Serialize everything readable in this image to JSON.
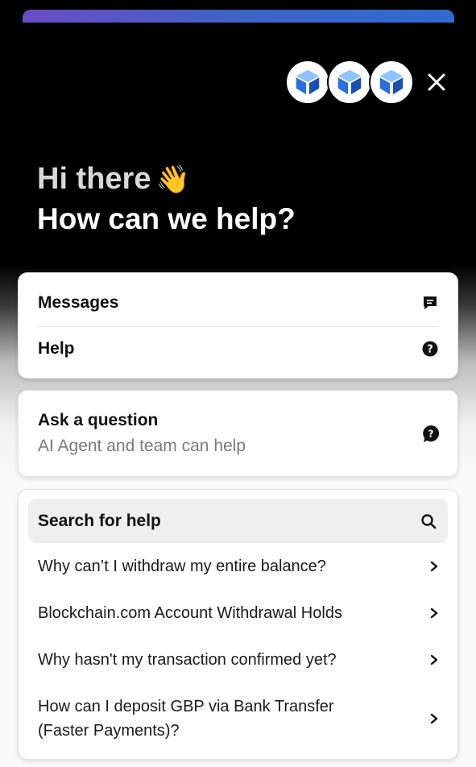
{
  "header": {
    "greeting": "Hi there",
    "wave_emoji": "👋",
    "headline": "How can we help?",
    "avatar_icon": "blockchain-cube-icon",
    "close_icon": "close-icon",
    "accent_gradient": [
      "#6a4cc6",
      "#2f6bd0"
    ]
  },
  "home_card": {
    "messages_label": "Messages",
    "messages_icon": "message-icon",
    "help_label": "Help",
    "help_icon": "question-circle-icon"
  },
  "ask_card": {
    "title": "Ask a question",
    "subtitle": "AI Agent and team can help",
    "icon": "question-bubble-icon"
  },
  "help_card": {
    "search_label": "Search for help",
    "search_icon": "search-icon",
    "articles": [
      "Why can’t I withdraw my entire balance?",
      "Blockchain.com Account Withdrawal Holds",
      "Why hasn't my transaction confirmed yet?",
      "How can I deposit GBP via Bank Transfer (Faster Payments)?"
    ],
    "chevron_icon": "chevron-right-icon"
  }
}
